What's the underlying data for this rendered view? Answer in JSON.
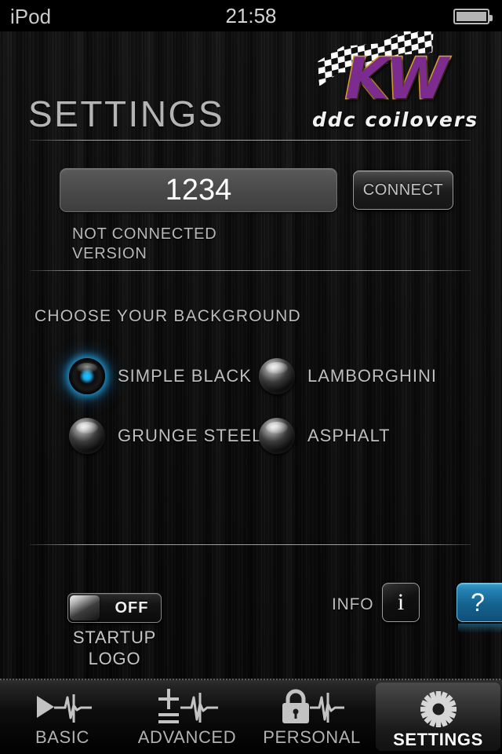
{
  "status_bar": {
    "carrier": "iPod",
    "time": "21:58",
    "battery_icon": "battery-full-icon"
  },
  "header": {
    "title": "SETTINGS",
    "logo": {
      "brand": "KW",
      "tagline": "ddc coilovers",
      "flag_icon": "checkered-flag-icon",
      "brand_color": "#7c2b8e",
      "brand_outline_color": "#d9a528"
    }
  },
  "connection": {
    "pin_value": "1234",
    "pin_placeholder": "PIN",
    "connect_label": "CONNECT",
    "status_text": "NOT CONNECTED",
    "version_text": "VERSION"
  },
  "background_section": {
    "heading": "CHOOSE YOUR BACKGROUND",
    "options": [
      {
        "label": "SIMPLE BLACK",
        "selected": true,
        "name": "radio-simple-black"
      },
      {
        "label": "LAMBORGHINI",
        "selected": false,
        "name": "radio-lamborghini"
      },
      {
        "label": "GRUNGE STEEL",
        "selected": false,
        "name": "radio-grunge-steel"
      },
      {
        "label": "ASPHALT",
        "selected": false,
        "name": "radio-asphalt"
      }
    ],
    "selected_accent_color": "#21aee8"
  },
  "footer_controls": {
    "startup_logo": {
      "toggle_state": "OFF",
      "caption_line1": "STARTUP",
      "caption_line2": "LOGO"
    },
    "info_label": "INFO",
    "info_button_glyph": "i",
    "help_button_glyph": "?",
    "help_button_color": "#14628f"
  },
  "tab_bar": {
    "tabs": [
      {
        "label": "BASIC",
        "icon": "play-waveform-icon",
        "active": false
      },
      {
        "label": "ADVANCED",
        "icon": "plusminus-waveform-icon",
        "active": false
      },
      {
        "label": "PERSONAL",
        "icon": "lock-waveform-icon",
        "active": false
      },
      {
        "label": "SETTINGS",
        "icon": "gear-icon",
        "active": true
      }
    ]
  }
}
